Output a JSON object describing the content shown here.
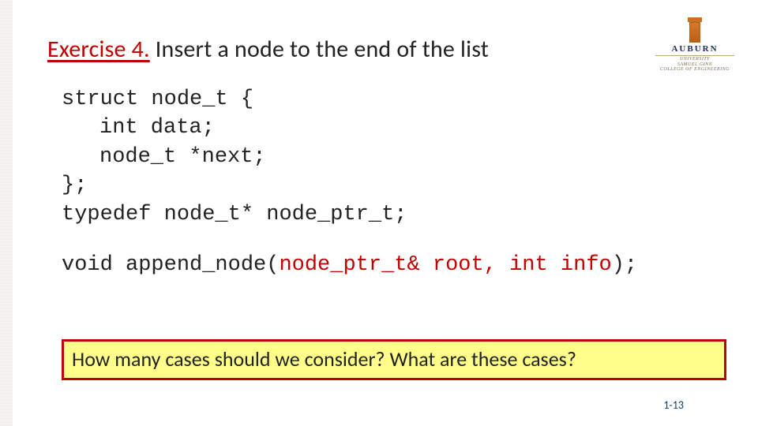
{
  "title": {
    "exercise_label": "Exercise 4.",
    "rest": " Insert a node to the end of the list"
  },
  "logo": {
    "wordmark": "AUBURN",
    "sub1": "UNIVERSITY",
    "sub2": "SAMUEL GINN",
    "sub3": "COLLEGE OF ENGINEERING"
  },
  "code": {
    "l1": "struct node_t {",
    "l2": "int data;",
    "l3": "node_t *next;",
    "l4": "};",
    "l5": "typedef node_t* node_ptr_t;",
    "l6a": "void append_node(",
    "l6b": "node_ptr_t& root, int info",
    "l6c": ");"
  },
  "callout": "How many cases should we consider? What are these cases?",
  "pagenum": "1-13"
}
